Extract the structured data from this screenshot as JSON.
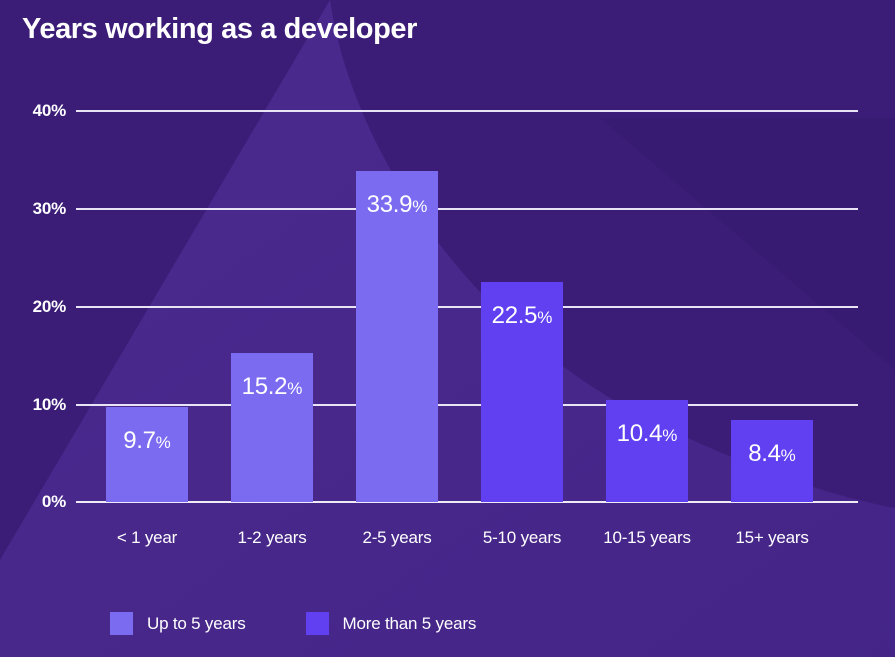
{
  "chart_data": {
    "type": "bar",
    "title": "Years working as a developer",
    "xlabel": "",
    "ylabel": "",
    "categories": [
      "< 1 year",
      "1-2 years",
      "2-5 years",
      "5-10 years",
      "10-15 years",
      "15+ years"
    ],
    "values": [
      9.7,
      15.2,
      33.9,
      22.5,
      10.4,
      8.4
    ],
    "value_labels": [
      "9.7",
      "15.2",
      "33.9",
      "22.5",
      "10.4",
      "8.4"
    ],
    "value_suffix": "%",
    "series_of_bar": [
      "Up to 5 years",
      "Up to 5 years",
      "Up to 5 years",
      "More than 5 years",
      "More than 5 years",
      "More than 5 years"
    ],
    "ylim": [
      0,
      40
    ],
    "yticks": [
      0,
      10,
      20,
      30,
      40
    ],
    "ytick_labels": [
      "0%",
      "10%",
      "20%",
      "30%",
      "40%"
    ],
    "grid": true,
    "legend_position": "bottom-left",
    "legend": [
      {
        "name": "Up to 5 years",
        "color": "#7a6bf0"
      },
      {
        "name": "More than 5 years",
        "color": "#6040f0"
      }
    ]
  },
  "colors": {
    "background": "#3b1d78",
    "background_accent": "#4a2a8c",
    "gridline": "#e8e4f6",
    "text": "#ffffff",
    "series_up_to_5": "#7a6bf0",
    "series_more_than_5": "#6040f0"
  }
}
